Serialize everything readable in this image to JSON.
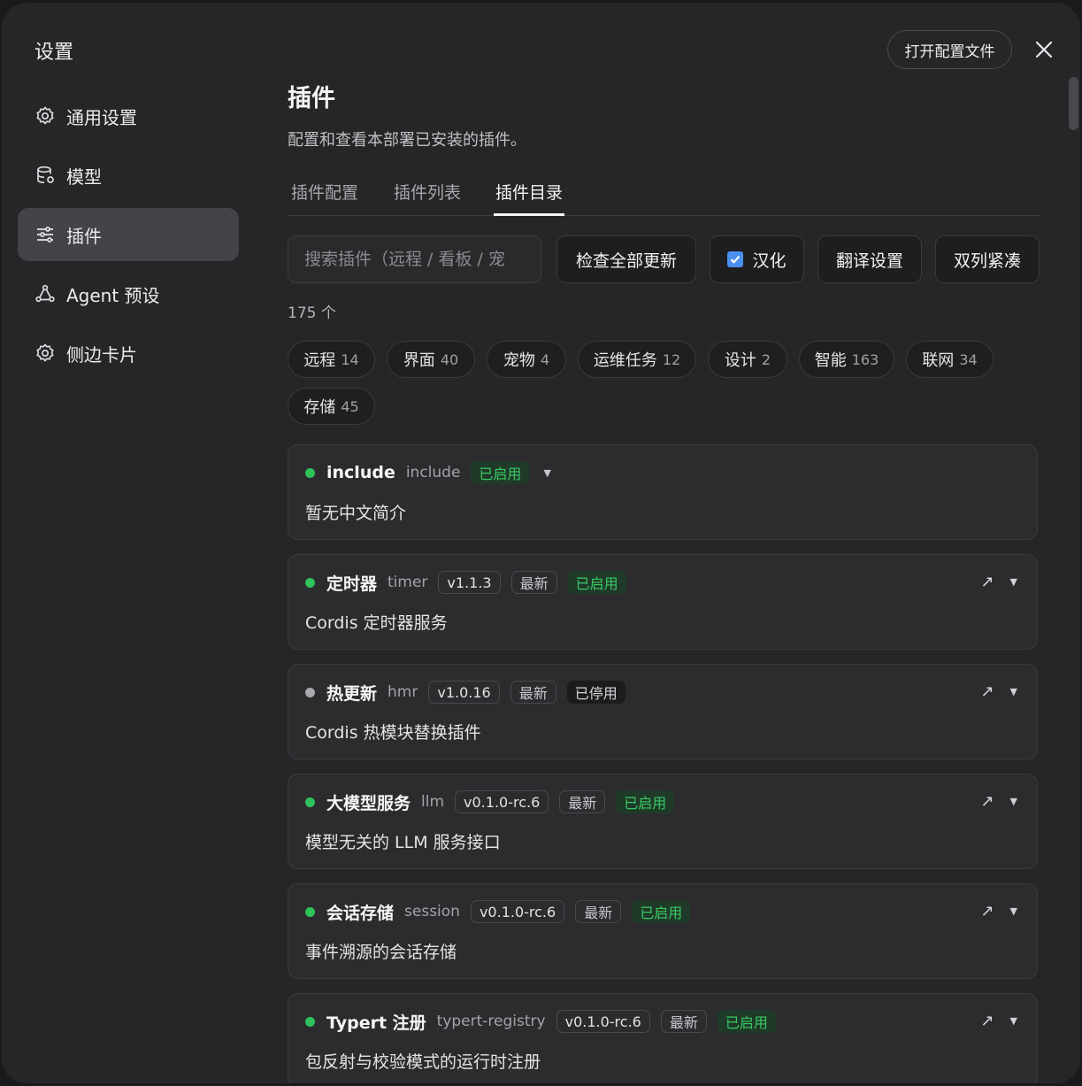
{
  "sidebar": {
    "title": "设置",
    "items": [
      {
        "label": "通用设置",
        "icon": "gear-icon"
      },
      {
        "label": "模型",
        "icon": "database-icon"
      },
      {
        "label": "插件",
        "icon": "sliders-icon",
        "active": true
      },
      {
        "label": "Agent 预设",
        "icon": "agent-icon"
      },
      {
        "label": "侧边卡片",
        "icon": "gear-icon"
      }
    ]
  },
  "header": {
    "open_config_label": "打开配置文件",
    "close_icon": "close-icon"
  },
  "main": {
    "title": "插件",
    "description": "配置和查看本部署已安装的插件。",
    "tabs": [
      {
        "label": "插件配置"
      },
      {
        "label": "插件列表"
      },
      {
        "label": "插件目录",
        "active": true
      }
    ],
    "search_placeholder": "搜索插件（远程 / 看板 / 宠",
    "buttons": {
      "check_updates": "检查全部更新",
      "localize": "汉化",
      "translate_settings": "翻译设置",
      "two_column": "双列紧凑"
    },
    "localize_checked": true,
    "count": "175 个",
    "categories": [
      {
        "name": "远程",
        "count": "14"
      },
      {
        "name": "界面",
        "count": "40"
      },
      {
        "name": "宠物",
        "count": "4"
      },
      {
        "name": "运维任务",
        "count": "12"
      },
      {
        "name": "设计",
        "count": "2"
      },
      {
        "name": "智能",
        "count": "163"
      },
      {
        "name": "联网",
        "count": "34"
      },
      {
        "name": "存储",
        "count": "45"
      }
    ],
    "plugins": [
      {
        "name": "include",
        "id": "include",
        "version": "",
        "latest": "",
        "status": "已启用",
        "enabled": true,
        "description": "暂无中文简介",
        "external": false
      },
      {
        "name": "定时器",
        "id": "timer",
        "version": "v1.1.3",
        "latest": "最新",
        "status": "已启用",
        "enabled": true,
        "description": "Cordis 定时器服务",
        "external": true
      },
      {
        "name": "热更新",
        "id": "hmr",
        "version": "v1.0.16",
        "latest": "最新",
        "status": "已停用",
        "enabled": false,
        "description": "Cordis 热模块替换插件",
        "external": true
      },
      {
        "name": "大模型服务",
        "id": "llm",
        "version": "v0.1.0-rc.6",
        "latest": "最新",
        "status": "已启用",
        "enabled": true,
        "description": "模型无关的 LLM 服务接口",
        "external": true
      },
      {
        "name": "会话存储",
        "id": "session",
        "version": "v0.1.0-rc.6",
        "latest": "最新",
        "status": "已启用",
        "enabled": true,
        "description": "事件溯源的会话存储",
        "external": true
      },
      {
        "name": "Typert 注册",
        "id": "typert-registry",
        "version": "v0.1.0-rc.6",
        "latest": "最新",
        "status": "已启用",
        "enabled": true,
        "description": "包反射与校验模式的运行时注册",
        "external": true
      }
    ],
    "colors": {
      "accent": "#2fc25b",
      "checkbox": "#4a90f0"
    }
  }
}
